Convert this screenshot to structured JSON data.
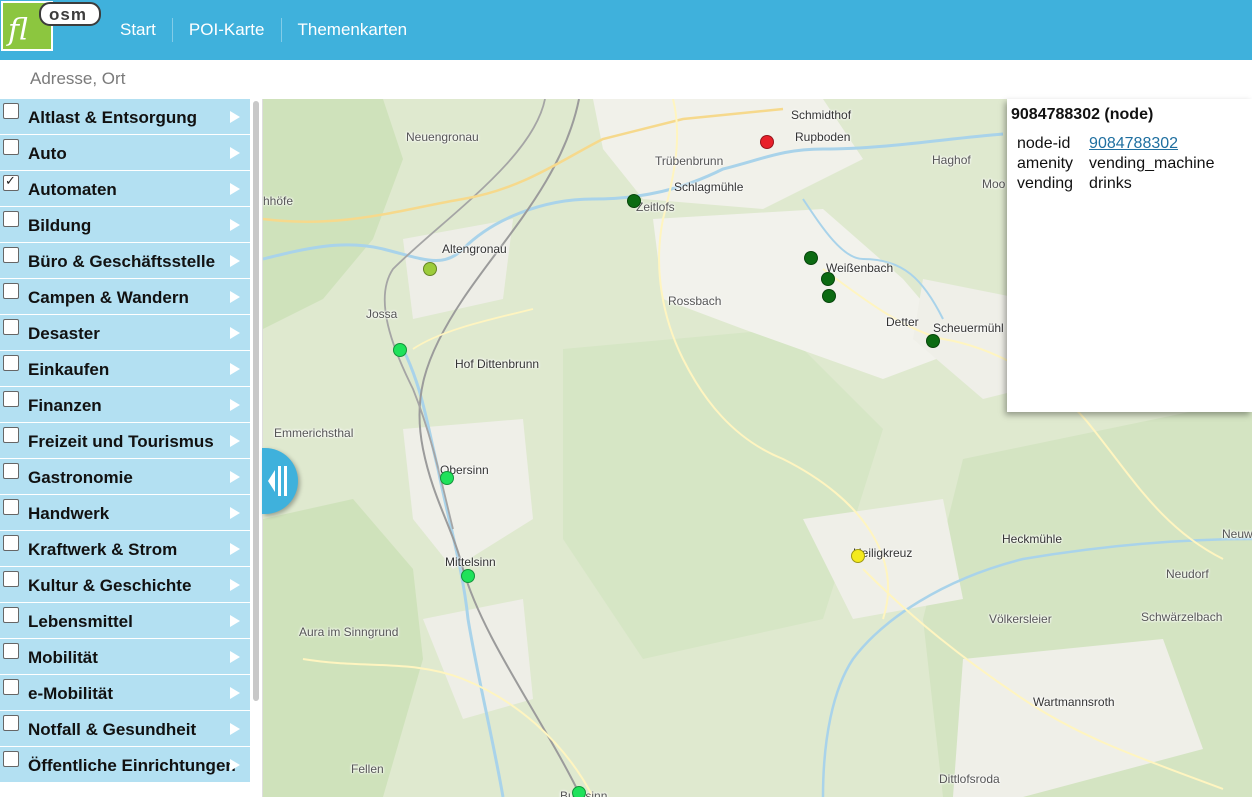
{
  "header": {
    "logo_main": "fl",
    "logo_sub": "osm",
    "nav": [
      "Start",
      "POI-Karte",
      "Themenkarten"
    ]
  },
  "search": {
    "placeholder": "Adresse, Ort",
    "value": ""
  },
  "categories": [
    {
      "label": "Altlast & Entsorgung",
      "checked": false
    },
    {
      "label": "Auto",
      "checked": false
    },
    {
      "label": "Automaten",
      "checked": true
    },
    {
      "label": "Bildung",
      "checked": false
    },
    {
      "label": "Büro & Geschäftsstelle",
      "checked": false
    },
    {
      "label": "Campen & Wandern",
      "checked": false
    },
    {
      "label": "Desaster",
      "checked": false
    },
    {
      "label": "Einkaufen",
      "checked": false
    },
    {
      "label": "Finanzen",
      "checked": false
    },
    {
      "label": "Freizeit und Tourismus",
      "checked": false
    },
    {
      "label": "Gastronomie",
      "checked": false
    },
    {
      "label": "Handwerk",
      "checked": false
    },
    {
      "label": "Kraftwerk & Strom",
      "checked": false
    },
    {
      "label": "Kultur & Geschichte",
      "checked": false
    },
    {
      "label": "Lebensmittel",
      "checked": false
    },
    {
      "label": "Mobilität",
      "checked": false
    },
    {
      "label": "e-Mobilität",
      "checked": false
    },
    {
      "label": "Notfall & Gesundheit",
      "checked": false
    },
    {
      "label": "Öffentliche Einrichtungen",
      "checked": false
    }
  ],
  "map": {
    "places": [
      "Neuengronau",
      "Trübenbrunn",
      "Schmidthof",
      "Rupboden",
      "Haghof",
      "Moo",
      "Schlagmühle",
      "Zeitlofs",
      "hhöfe",
      "Altengronau",
      "Weißenbach",
      "Rossbach",
      "Jossa",
      "Detter",
      "Scheuermühl",
      "Hof Dittenbrunn",
      "Emmerichsthal",
      "Obersinn",
      "Heckmühle",
      "Neuwirts",
      "Heiligkreuz",
      "Mittelsinn",
      "Neudorf",
      "Aura im Sinngrund",
      "Völkersleier",
      "Schwärzelbach",
      "Wartmannsroth",
      "Fellen",
      "Dittlofsroda",
      "Burgsinn"
    ],
    "pois": [
      {
        "color": "#e8202a"
      },
      {
        "color": "#0c6b12"
      },
      {
        "color": "#0c6b12"
      },
      {
        "color": "#0c6b12"
      },
      {
        "color": "#0c6b12"
      },
      {
        "color": "#0c6b12"
      },
      {
        "color": "#9ccc3b"
      },
      {
        "color": "#1fe25b"
      },
      {
        "color": "#1fe25b"
      },
      {
        "color": "#1fe25b"
      },
      {
        "color": "#1fe25b"
      },
      {
        "color": "#f4ea1e"
      }
    ]
  },
  "popup": {
    "title": "9084788302 (node)",
    "rows": [
      {
        "key": "node-id",
        "value": "9084788302",
        "link": true
      },
      {
        "key": "amenity",
        "value": "vending_machine",
        "link": false
      },
      {
        "key": "vending",
        "value": "drinks",
        "link": false
      }
    ]
  },
  "colors": {
    "header": "#3fb1dc",
    "sidebar_item": "#b3e0f2"
  }
}
